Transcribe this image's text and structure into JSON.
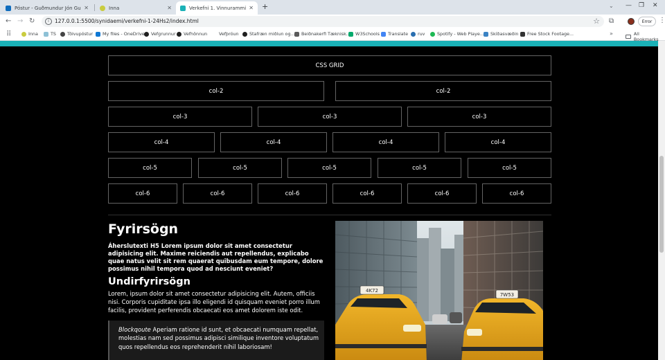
{
  "tabs": [
    {
      "label": "Póstur - Guðmundur Jón Guðjó",
      "icon": "outlook-icon",
      "active": false
    },
    {
      "label": "Inna",
      "icon": "inna-icon",
      "active": false
    },
    {
      "label": "Verkefni 1. Vinnurammi",
      "icon": "live-server-icon",
      "active": true
    }
  ],
  "toolbar": {
    "url": "127.0.0.1:5500/synidaemi/verkefni-1-24Hs2/index.html",
    "error_label": "Error"
  },
  "bookmarks": [
    {
      "label": "Inna",
      "icon": "inna-icon"
    },
    {
      "label": "TS",
      "icon": "ts-icon"
    },
    {
      "label": "Tölvupóstur",
      "icon": "mail-icon"
    },
    {
      "label": "My files - OneDrive",
      "icon": "onedrive-icon"
    },
    {
      "label": "Vefgrunnur",
      "icon": "github-icon"
    },
    {
      "label": "Vefhönnun",
      "icon": "github-icon"
    },
    {
      "label": "Vefþróun",
      "icon": "blank-icon"
    },
    {
      "label": "Stafræn miðlun og...",
      "icon": "github-icon"
    },
    {
      "label": "Beiðnakerfi Tæknisk...",
      "icon": "ticket-icon"
    },
    {
      "label": "W3Schools",
      "icon": "w3schools-icon"
    },
    {
      "label": "Translate",
      "icon": "translate-icon"
    },
    {
      "label": "ruv",
      "icon": "ruv-icon"
    },
    {
      "label": "Spotify - Web Playe...",
      "icon": "spotify-icon"
    },
    {
      "label": "Skíðasvæðin",
      "icon": "ski-icon"
    },
    {
      "label": "Free Stock Footage...",
      "icon": "footage-icon"
    }
  ],
  "all_bookmarks_label": "All Bookmarks",
  "grid": {
    "header": "CSS GRID",
    "rows": [
      {
        "label": "col-2",
        "count": 2
      },
      {
        "label": "col-3",
        "count": 3
      },
      {
        "label": "col-4",
        "count": 4
      },
      {
        "label": "col-5",
        "count": 5
      },
      {
        "label": "col-6",
        "count": 6
      }
    ]
  },
  "content": {
    "heading": "Fyrirsögn",
    "h5_text": "Áherslutexti H5 Lorem ipsum dolor sit amet consectetur adipisicing elit. Maxime reiciendis aut repellendus, explicabo quae natus velit sit rem quaerat quibusdam eum tempore, dolore possimus nihil tempora quod ad nesciunt eveniet?",
    "subheading": "Undirfyrirsögn",
    "paragraph": "Lorem, ipsum dolor sit amet consectetur adipisicing elit. Autem, officiis nisi. Corporis cupiditate ipsa illo eligendi id quisquam eveniet porro illum facilis, provident perferendis obcaecati eos amet dolorem iste odit.",
    "blockquote_label": "Blockqoute",
    "blockquote_text": " Aperiam ratione id sunt, et obcaecati numquam repellat, molestias nam sed possimus adipisci similique inventore voluptatum quos repellendus eos reprehenderit nihil laboriosam!"
  },
  "photo": {
    "subject": "yellow taxi cabs on a city street",
    "taxi_sign_left": "4K72",
    "taxi_sign_right": "7W53"
  },
  "colors": {
    "accent_strip": "#1ab1b7",
    "page_background": "#000000",
    "cell_border": "#646464",
    "taxi_yellow": "#e6a818"
  }
}
